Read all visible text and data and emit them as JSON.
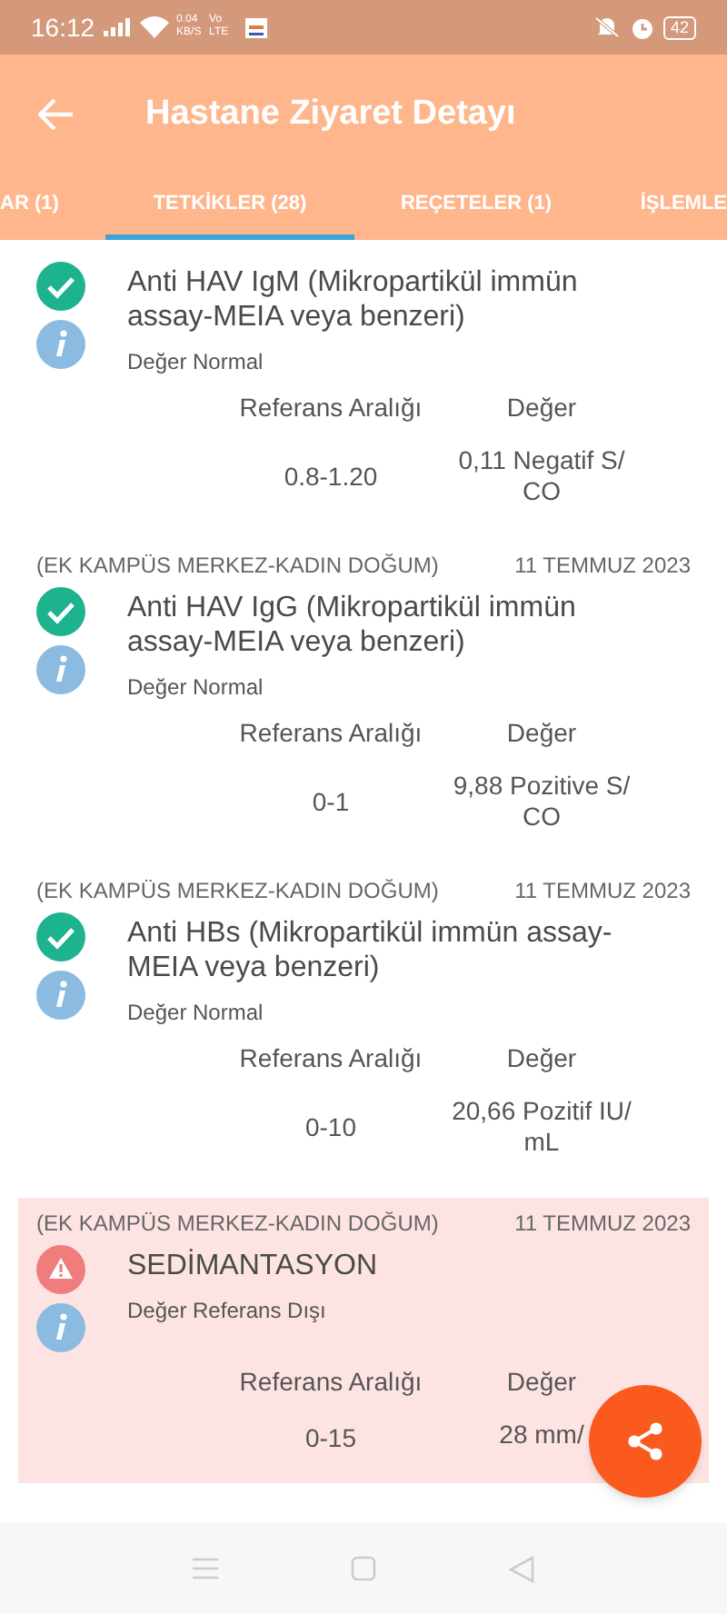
{
  "status_bar": {
    "time": "16:12",
    "speed": "0.04 KB/S",
    "network": "Vo LTE",
    "battery": "42"
  },
  "app_bar": {
    "title": "Hastane Ziyaret Detayı"
  },
  "tabs": [
    {
      "label": "AR (1)",
      "selected": false
    },
    {
      "label": "TETKİKLER (28)",
      "selected": true
    },
    {
      "label": "REÇETELER (1)",
      "selected": false
    },
    {
      "label": "İŞLEMLE",
      "selected": false
    }
  ],
  "results": [
    {
      "kind": "normal",
      "title": "Anti HAV IgM (Mikropartikül immün assay-MEIA veya benzeri)",
      "status": "Değer Normal",
      "range_label": "Referans Aralığı",
      "value_label": "Değer",
      "range": "0.8-1.20",
      "value": "0,11 Negatif S/ CO"
    },
    {
      "kind": "normal",
      "location": "(EK KAMPÜS MERKEZ-KADIN DOĞUM)",
      "date": "11 TEMMUZ 2023",
      "title": "Anti HAV IgG (Mikropartikül immün assay-MEIA veya benzeri)",
      "status": "Değer Normal",
      "range_label": "Referans Aralığı",
      "value_label": "Değer",
      "range": "0-1",
      "value": "9,88 Pozitive S/ CO"
    },
    {
      "kind": "normal",
      "location": "(EK KAMPÜS MERKEZ-KADIN DOĞUM)",
      "date": "11 TEMMUZ 2023",
      "title": "Anti HBs  (Mikropartikül immün assay-MEIA veya benzeri)",
      "status": "Değer Normal",
      "range_label": "Referans Aralığı",
      "value_label": "Değer",
      "range": "0-10",
      "value": "20,66 Pozitif IU/ mL"
    },
    {
      "kind": "out_of_range",
      "location": "(EK KAMPÜS MERKEZ-KADIN DOĞUM)",
      "date": "11 TEMMUZ 2023",
      "title": "SEDİMANTASYON",
      "status": "Değer Referans Dışı",
      "range_label": "Referans Aralığı",
      "value_label": "Değer",
      "range": "0-15",
      "value": "28 mm/"
    }
  ]
}
